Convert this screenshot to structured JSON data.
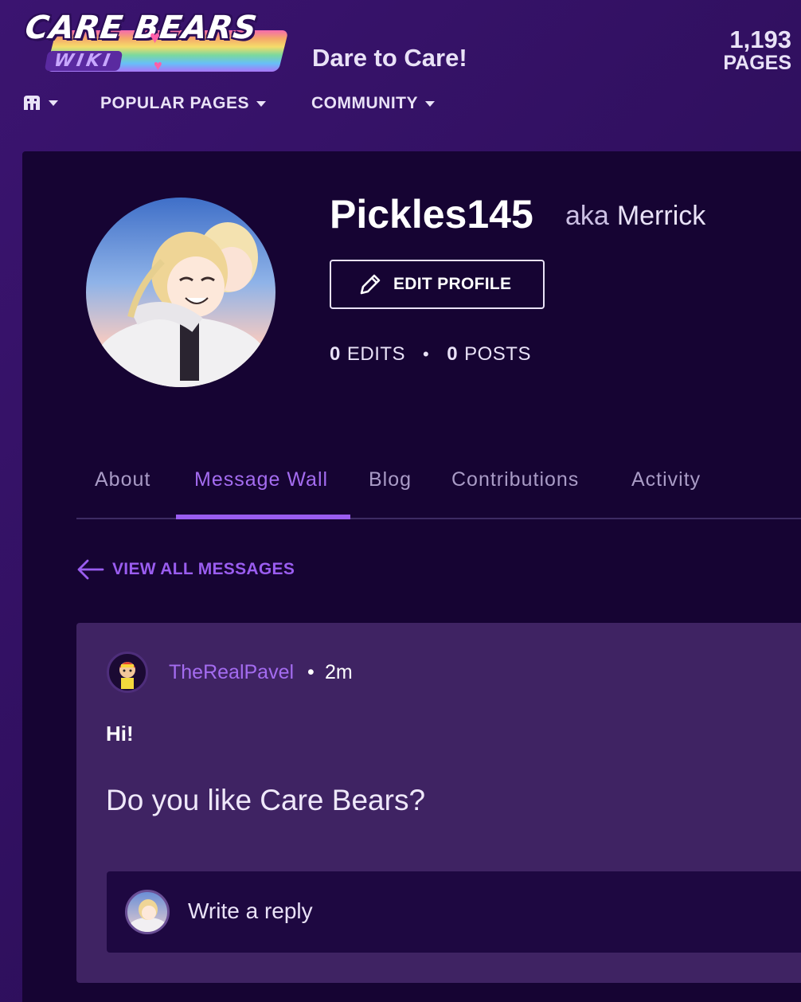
{
  "header": {
    "logo_text": "CARE BEARS",
    "logo_subtext": "WIKI",
    "tagline": "Dare to Care!",
    "page_count": "1,193",
    "page_count_label": "PAGES"
  },
  "nav": {
    "items": [
      {
        "label": "POPULAR PAGES"
      },
      {
        "label": "COMMUNITY"
      }
    ]
  },
  "profile": {
    "username": "Pickles145",
    "aka_word": "aka",
    "aka_name": "Merrick",
    "edit_profile_label": "EDIT PROFILE",
    "edits_count": "0",
    "edits_label": "EDITS",
    "posts_count": "0",
    "posts_label": "POSTS",
    "stat_separator": "•"
  },
  "tabs": [
    {
      "label": "About",
      "active": false
    },
    {
      "label": "Message Wall",
      "active": true
    },
    {
      "label": "Blog",
      "active": false
    },
    {
      "label": "Contributions",
      "active": false
    },
    {
      "label": "Activity",
      "active": false
    }
  ],
  "message_wall": {
    "view_all_label": "VIEW ALL MESSAGES",
    "message": {
      "author": "TheRealPavel",
      "separator": "•",
      "time": "2m",
      "title": "Hi!",
      "body": "Do you like Care Bears?"
    },
    "reply_placeholder": "Write a reply"
  },
  "colors": {
    "accent": "#9a5df0",
    "background": "#2e0f5c",
    "panel": "#160433",
    "card": "#3f2363"
  },
  "icons": [
    "wiki-icon",
    "pencil-icon",
    "arrow-left-icon",
    "chevron-down-icon"
  ]
}
